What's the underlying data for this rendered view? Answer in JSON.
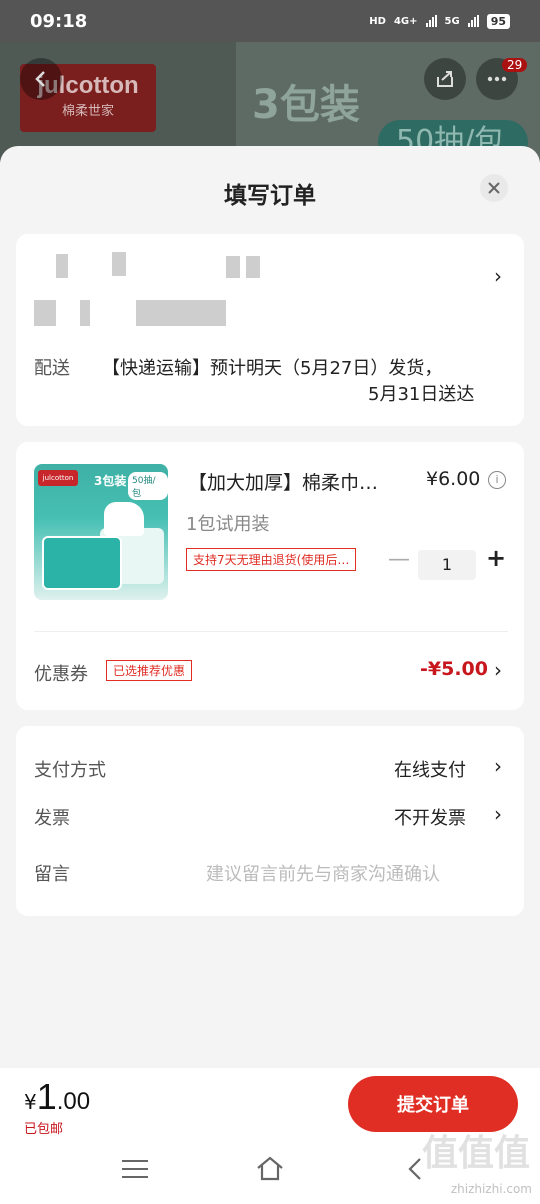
{
  "status_bar": {
    "time": "09:18",
    "network": "4G+",
    "network2": "5G",
    "battery": "95"
  },
  "background_banner": {
    "brand": "julcotton",
    "brand_cn": "棉柔世家",
    "headline": "3包装",
    "pill": "50抽/包",
    "notification_count": "29"
  },
  "sheet": {
    "title": "填写订单",
    "close_icon": "close-icon"
  },
  "address": {
    "delivery_label": "配送",
    "delivery_line1": "【快递运输】预计明天（5月27日）发货，",
    "delivery_line2": "5月31日送达"
  },
  "product": {
    "title": "【加大加厚】棉柔巾…",
    "price": "¥6.00",
    "spec": "1包试用装",
    "return_policy": "支持7天无理由退货(使用后…",
    "quantity": "1",
    "thumb_brand": "julcotton",
    "thumb_headline": "3包装",
    "thumb_pill": "50抽/包"
  },
  "coupon": {
    "label": "优惠券",
    "tag": "已选推荐优惠",
    "value": "-¥5.00"
  },
  "payment": {
    "method_label": "支付方式",
    "method_value": "在线支付",
    "invoice_label": "发票",
    "invoice_value": "不开发票",
    "message_label": "留言",
    "message_placeholder": "建议留言前先与商家沟通确认"
  },
  "footer": {
    "currency": "¥",
    "total_int": "1",
    "total_dec": ".00",
    "shipping": "已包邮",
    "submit_label": "提交订单",
    "watermark": "zhizhizhi.com"
  },
  "colors": {
    "accent": "#e02e24",
    "price_red": "#c8161d"
  }
}
